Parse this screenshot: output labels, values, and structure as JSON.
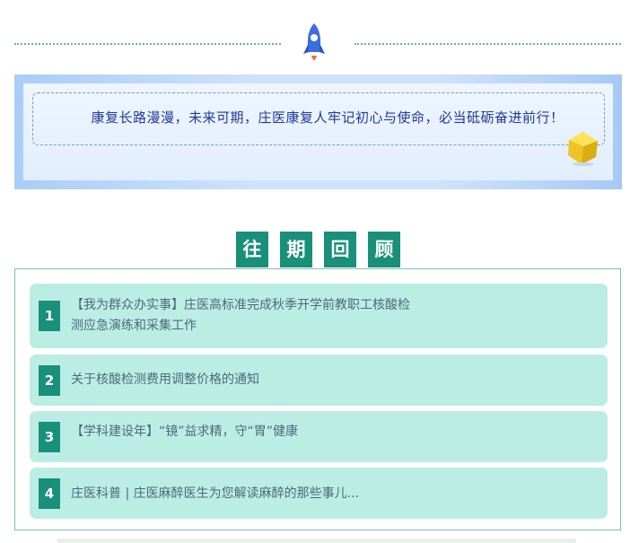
{
  "header": {
    "icon": "rocket-icon",
    "accent_color": "#6fa4dc"
  },
  "quote": {
    "text": "康复长路漫漫，未来可期，庄医康复人牢记初心与使命，必当砥砺奋进前行！",
    "decoration_icon": "gem-icon"
  },
  "review": {
    "title_chars": [
      "往",
      "期",
      "回",
      "顾"
    ],
    "accent_color": "#18907a",
    "card_color": "#bcede5",
    "items": [
      {
        "number": "1",
        "line1": "【我为群众办实事】庄医高标准完成秋季开学前教职工核酸检",
        "line2": "测应急演练和采集工作"
      },
      {
        "number": "2",
        "line1": "关于核酸检测费用调整价格的通知"
      },
      {
        "number": "3",
        "line1": "【学科建设年】“镜”益求精，守“胃”健康"
      },
      {
        "number": "4",
        "line1": "庄医科普 | 庄医麻醉医生为您解读麻醉的那些事儿..."
      }
    ]
  }
}
